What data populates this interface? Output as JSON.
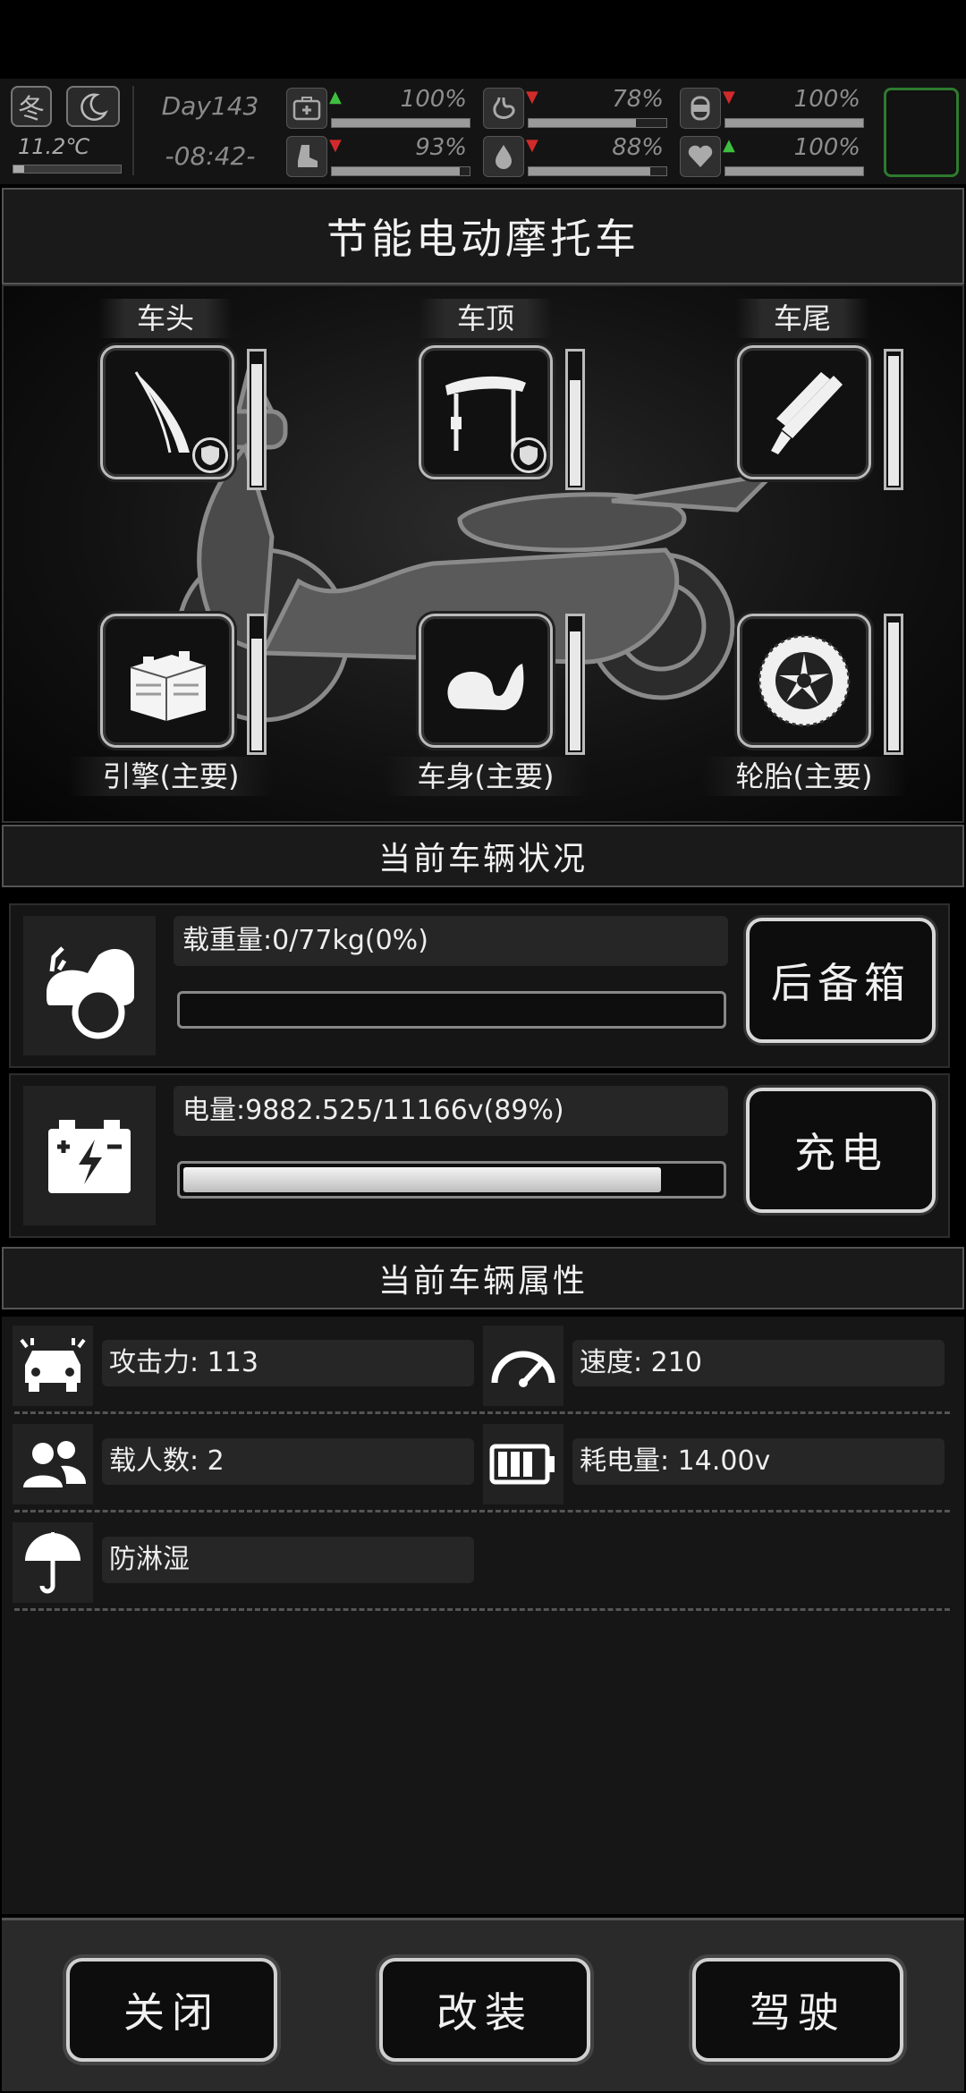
{
  "status": {
    "season": "冬",
    "temperature": "11.2℃",
    "temperature_level": 0.1,
    "day": "Day143",
    "time": "-08:42-",
    "stats": [
      {
        "icon": "medkit-icon",
        "trend": "up",
        "value": "100%",
        "level": 1.0
      },
      {
        "icon": "stomach-icon",
        "trend": "down",
        "value": "78%",
        "level": 0.78
      },
      {
        "icon": "bandage-icon",
        "trend": "down",
        "value": "100%",
        "level": 1.0
      },
      {
        "icon": "boot-icon",
        "trend": "down",
        "value": "93%",
        "level": 0.93
      },
      {
        "icon": "water-drop-icon",
        "trend": "down",
        "value": "88%",
        "level": 0.88
      },
      {
        "icon": "heart-icon",
        "trend": "up",
        "value": "100%",
        "level": 1.0
      }
    ]
  },
  "vehicle": {
    "title": "节能电动摩托车",
    "parts": {
      "head": {
        "label": "车头",
        "level": 0.92
      },
      "roof": {
        "label": "车顶",
        "level": 0.8
      },
      "tail": {
        "label": "车尾",
        "level": 0.98
      },
      "engine": {
        "label": "引擎(主要)",
        "level": 0.85
      },
      "body": {
        "label": "车身(主要)",
        "level": 0.9
      },
      "tire": {
        "label": "轮胎(主要)",
        "level": 0.97
      }
    }
  },
  "condition": {
    "section_title": "当前车辆状况",
    "load_text": "载重量:0/77kg(0%)",
    "load_level": 0.0,
    "storage_button": "后备箱",
    "battery_text": "电量:9882.525/11166v(89%)",
    "battery_level": 0.89,
    "charge_button": "充电"
  },
  "attributes": {
    "section_title": "当前车辆属性",
    "attack": "攻击力: 113",
    "speed": "速度: 210",
    "passengers": "载人数: 2",
    "power_use": "耗电量: 14.00v",
    "feature": "防淋湿"
  },
  "buttons": {
    "close": "关闭",
    "modify": "改装",
    "drive": "驾驶"
  },
  "colors": {
    "background": "#000000",
    "panel": "#1a1a1a",
    "accent_green": "#2e7a2e",
    "trend_up": "#3fbf3f",
    "trend_down": "#d22a2a"
  }
}
